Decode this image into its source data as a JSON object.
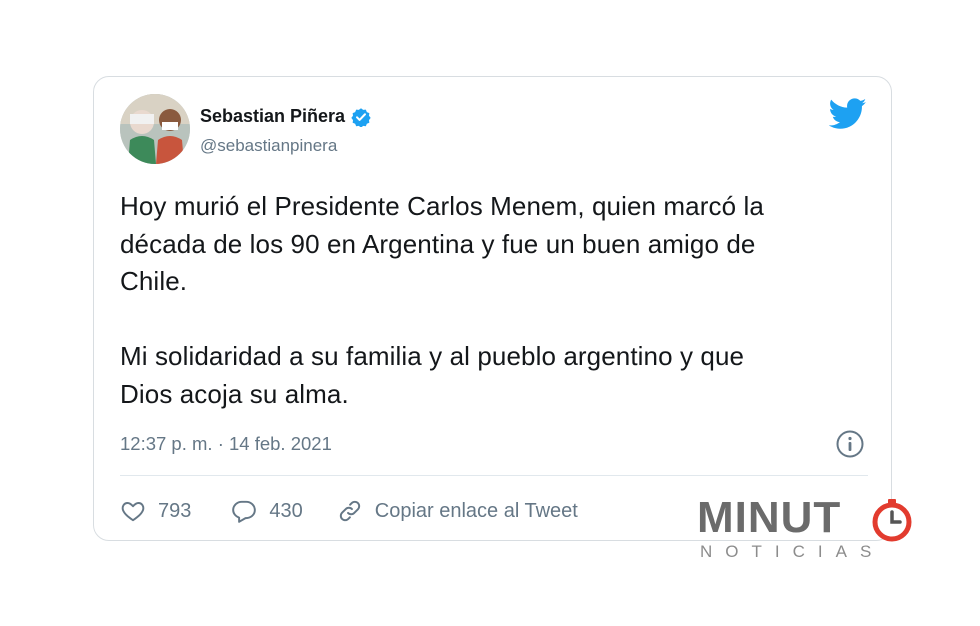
{
  "tweet": {
    "author_name": "Sebastian Piñera",
    "handle": "@sebastianpinera",
    "text_lines_p1": [
      "Hoy murió el Presidente Carlos Menem, quien marcó la",
      "década de los 90 en Argentina y fue un buen amigo de",
      "Chile."
    ],
    "text_lines_p2": [
      "Mi solidaridad a su familia y al pueblo argentino y que",
      "Dios acoja su alma."
    ],
    "timestamp": "12:37 p. m. · 14 feb. 2021",
    "likes": "793",
    "replies": "430",
    "copy_link_label": "Copiar enlace al Tweet"
  },
  "icons": {
    "verified": "verified-badge-icon",
    "brand": "twitter-bird-icon",
    "info": "info-icon",
    "like": "heart-icon",
    "reply": "speech-bubble-icon",
    "link": "link-icon"
  },
  "watermark": {
    "logo_text_main": "MINUT",
    "logo_text_sub": "NOTICIAS"
  },
  "colors": {
    "twitter_blue": "#1da1f2",
    "secondary_text": "#657786",
    "watermark_red": "#e23b2e"
  }
}
